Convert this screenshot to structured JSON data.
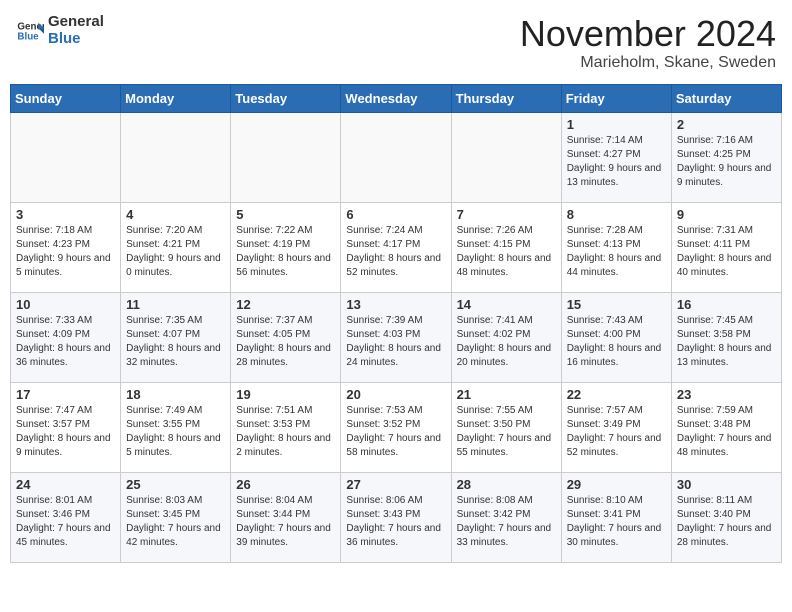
{
  "logo": {
    "line1": "General",
    "line2": "Blue"
  },
  "title": "November 2024",
  "subtitle": "Marieholm, Skane, Sweden",
  "weekdays": [
    "Sunday",
    "Monday",
    "Tuesday",
    "Wednesday",
    "Thursday",
    "Friday",
    "Saturday"
  ],
  "weeks": [
    [
      {
        "day": "",
        "info": ""
      },
      {
        "day": "",
        "info": ""
      },
      {
        "day": "",
        "info": ""
      },
      {
        "day": "",
        "info": ""
      },
      {
        "day": "",
        "info": ""
      },
      {
        "day": "1",
        "info": "Sunrise: 7:14 AM\nSunset: 4:27 PM\nDaylight: 9 hours and 13 minutes."
      },
      {
        "day": "2",
        "info": "Sunrise: 7:16 AM\nSunset: 4:25 PM\nDaylight: 9 hours and 9 minutes."
      }
    ],
    [
      {
        "day": "3",
        "info": "Sunrise: 7:18 AM\nSunset: 4:23 PM\nDaylight: 9 hours and 5 minutes."
      },
      {
        "day": "4",
        "info": "Sunrise: 7:20 AM\nSunset: 4:21 PM\nDaylight: 9 hours and 0 minutes."
      },
      {
        "day": "5",
        "info": "Sunrise: 7:22 AM\nSunset: 4:19 PM\nDaylight: 8 hours and 56 minutes."
      },
      {
        "day": "6",
        "info": "Sunrise: 7:24 AM\nSunset: 4:17 PM\nDaylight: 8 hours and 52 minutes."
      },
      {
        "day": "7",
        "info": "Sunrise: 7:26 AM\nSunset: 4:15 PM\nDaylight: 8 hours and 48 minutes."
      },
      {
        "day": "8",
        "info": "Sunrise: 7:28 AM\nSunset: 4:13 PM\nDaylight: 8 hours and 44 minutes."
      },
      {
        "day": "9",
        "info": "Sunrise: 7:31 AM\nSunset: 4:11 PM\nDaylight: 8 hours and 40 minutes."
      }
    ],
    [
      {
        "day": "10",
        "info": "Sunrise: 7:33 AM\nSunset: 4:09 PM\nDaylight: 8 hours and 36 minutes."
      },
      {
        "day": "11",
        "info": "Sunrise: 7:35 AM\nSunset: 4:07 PM\nDaylight: 8 hours and 32 minutes."
      },
      {
        "day": "12",
        "info": "Sunrise: 7:37 AM\nSunset: 4:05 PM\nDaylight: 8 hours and 28 minutes."
      },
      {
        "day": "13",
        "info": "Sunrise: 7:39 AM\nSunset: 4:03 PM\nDaylight: 8 hours and 24 minutes."
      },
      {
        "day": "14",
        "info": "Sunrise: 7:41 AM\nSunset: 4:02 PM\nDaylight: 8 hours and 20 minutes."
      },
      {
        "day": "15",
        "info": "Sunrise: 7:43 AM\nSunset: 4:00 PM\nDaylight: 8 hours and 16 minutes."
      },
      {
        "day": "16",
        "info": "Sunrise: 7:45 AM\nSunset: 3:58 PM\nDaylight: 8 hours and 13 minutes."
      }
    ],
    [
      {
        "day": "17",
        "info": "Sunrise: 7:47 AM\nSunset: 3:57 PM\nDaylight: 8 hours and 9 minutes."
      },
      {
        "day": "18",
        "info": "Sunrise: 7:49 AM\nSunset: 3:55 PM\nDaylight: 8 hours and 5 minutes."
      },
      {
        "day": "19",
        "info": "Sunrise: 7:51 AM\nSunset: 3:53 PM\nDaylight: 8 hours and 2 minutes."
      },
      {
        "day": "20",
        "info": "Sunrise: 7:53 AM\nSunset: 3:52 PM\nDaylight: 7 hours and 58 minutes."
      },
      {
        "day": "21",
        "info": "Sunrise: 7:55 AM\nSunset: 3:50 PM\nDaylight: 7 hours and 55 minutes."
      },
      {
        "day": "22",
        "info": "Sunrise: 7:57 AM\nSunset: 3:49 PM\nDaylight: 7 hours and 52 minutes."
      },
      {
        "day": "23",
        "info": "Sunrise: 7:59 AM\nSunset: 3:48 PM\nDaylight: 7 hours and 48 minutes."
      }
    ],
    [
      {
        "day": "24",
        "info": "Sunrise: 8:01 AM\nSunset: 3:46 PM\nDaylight: 7 hours and 45 minutes."
      },
      {
        "day": "25",
        "info": "Sunrise: 8:03 AM\nSunset: 3:45 PM\nDaylight: 7 hours and 42 minutes."
      },
      {
        "day": "26",
        "info": "Sunrise: 8:04 AM\nSunset: 3:44 PM\nDaylight: 7 hours and 39 minutes."
      },
      {
        "day": "27",
        "info": "Sunrise: 8:06 AM\nSunset: 3:43 PM\nDaylight: 7 hours and 36 minutes."
      },
      {
        "day": "28",
        "info": "Sunrise: 8:08 AM\nSunset: 3:42 PM\nDaylight: 7 hours and 33 minutes."
      },
      {
        "day": "29",
        "info": "Sunrise: 8:10 AM\nSunset: 3:41 PM\nDaylight: 7 hours and 30 minutes."
      },
      {
        "day": "30",
        "info": "Sunrise: 8:11 AM\nSunset: 3:40 PM\nDaylight: 7 hours and 28 minutes."
      }
    ]
  ]
}
